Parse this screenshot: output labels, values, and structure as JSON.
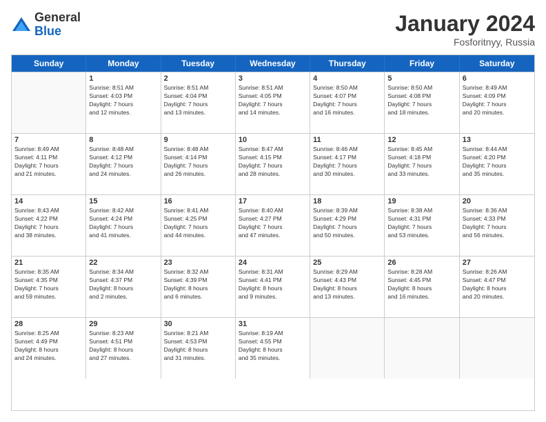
{
  "logo": {
    "general": "General",
    "blue": "Blue"
  },
  "title": "January 2024",
  "location": "Fosforitnyy, Russia",
  "days_header": [
    "Sunday",
    "Monday",
    "Tuesday",
    "Wednesday",
    "Thursday",
    "Friday",
    "Saturday"
  ],
  "weeks": [
    [
      {
        "day": "",
        "info": ""
      },
      {
        "day": "1",
        "info": "Sunrise: 8:51 AM\nSunset: 4:03 PM\nDaylight: 7 hours\nand 12 minutes."
      },
      {
        "day": "2",
        "info": "Sunrise: 8:51 AM\nSunset: 4:04 PM\nDaylight: 7 hours\nand 13 minutes."
      },
      {
        "day": "3",
        "info": "Sunrise: 8:51 AM\nSunset: 4:05 PM\nDaylight: 7 hours\nand 14 minutes."
      },
      {
        "day": "4",
        "info": "Sunrise: 8:50 AM\nSunset: 4:07 PM\nDaylight: 7 hours\nand 16 minutes."
      },
      {
        "day": "5",
        "info": "Sunrise: 8:50 AM\nSunset: 4:08 PM\nDaylight: 7 hours\nand 18 minutes."
      },
      {
        "day": "6",
        "info": "Sunrise: 8:49 AM\nSunset: 4:09 PM\nDaylight: 7 hours\nand 20 minutes."
      }
    ],
    [
      {
        "day": "7",
        "info": "Sunrise: 8:49 AM\nSunset: 4:11 PM\nDaylight: 7 hours\nand 21 minutes."
      },
      {
        "day": "8",
        "info": "Sunrise: 8:48 AM\nSunset: 4:12 PM\nDaylight: 7 hours\nand 24 minutes."
      },
      {
        "day": "9",
        "info": "Sunrise: 8:48 AM\nSunset: 4:14 PM\nDaylight: 7 hours\nand 26 minutes."
      },
      {
        "day": "10",
        "info": "Sunrise: 8:47 AM\nSunset: 4:15 PM\nDaylight: 7 hours\nand 28 minutes."
      },
      {
        "day": "11",
        "info": "Sunrise: 8:46 AM\nSunset: 4:17 PM\nDaylight: 7 hours\nand 30 minutes."
      },
      {
        "day": "12",
        "info": "Sunrise: 8:45 AM\nSunset: 4:18 PM\nDaylight: 7 hours\nand 33 minutes."
      },
      {
        "day": "13",
        "info": "Sunrise: 8:44 AM\nSunset: 4:20 PM\nDaylight: 7 hours\nand 35 minutes."
      }
    ],
    [
      {
        "day": "14",
        "info": "Sunrise: 8:43 AM\nSunset: 4:22 PM\nDaylight: 7 hours\nand 38 minutes."
      },
      {
        "day": "15",
        "info": "Sunrise: 8:42 AM\nSunset: 4:24 PM\nDaylight: 7 hours\nand 41 minutes."
      },
      {
        "day": "16",
        "info": "Sunrise: 8:41 AM\nSunset: 4:25 PM\nDaylight: 7 hours\nand 44 minutes."
      },
      {
        "day": "17",
        "info": "Sunrise: 8:40 AM\nSunset: 4:27 PM\nDaylight: 7 hours\nand 47 minutes."
      },
      {
        "day": "18",
        "info": "Sunrise: 8:39 AM\nSunset: 4:29 PM\nDaylight: 7 hours\nand 50 minutes."
      },
      {
        "day": "19",
        "info": "Sunrise: 8:38 AM\nSunset: 4:31 PM\nDaylight: 7 hours\nand 53 minutes."
      },
      {
        "day": "20",
        "info": "Sunrise: 8:36 AM\nSunset: 4:33 PM\nDaylight: 7 hours\nand 56 minutes."
      }
    ],
    [
      {
        "day": "21",
        "info": "Sunrise: 8:35 AM\nSunset: 4:35 PM\nDaylight: 7 hours\nand 59 minutes."
      },
      {
        "day": "22",
        "info": "Sunrise: 8:34 AM\nSunset: 4:37 PM\nDaylight: 8 hours\nand 2 minutes."
      },
      {
        "day": "23",
        "info": "Sunrise: 8:32 AM\nSunset: 4:39 PM\nDaylight: 8 hours\nand 6 minutes."
      },
      {
        "day": "24",
        "info": "Sunrise: 8:31 AM\nSunset: 4:41 PM\nDaylight: 8 hours\nand 9 minutes."
      },
      {
        "day": "25",
        "info": "Sunrise: 8:29 AM\nSunset: 4:43 PM\nDaylight: 8 hours\nand 13 minutes."
      },
      {
        "day": "26",
        "info": "Sunrise: 8:28 AM\nSunset: 4:45 PM\nDaylight: 8 hours\nand 16 minutes."
      },
      {
        "day": "27",
        "info": "Sunrise: 8:26 AM\nSunset: 4:47 PM\nDaylight: 8 hours\nand 20 minutes."
      }
    ],
    [
      {
        "day": "28",
        "info": "Sunrise: 8:25 AM\nSunset: 4:49 PM\nDaylight: 8 hours\nand 24 minutes."
      },
      {
        "day": "29",
        "info": "Sunrise: 8:23 AM\nSunset: 4:51 PM\nDaylight: 8 hours\nand 27 minutes."
      },
      {
        "day": "30",
        "info": "Sunrise: 8:21 AM\nSunset: 4:53 PM\nDaylight: 8 hours\nand 31 minutes."
      },
      {
        "day": "31",
        "info": "Sunrise: 8:19 AM\nSunset: 4:55 PM\nDaylight: 8 hours\nand 35 minutes."
      },
      {
        "day": "",
        "info": ""
      },
      {
        "day": "",
        "info": ""
      },
      {
        "day": "",
        "info": ""
      }
    ]
  ]
}
